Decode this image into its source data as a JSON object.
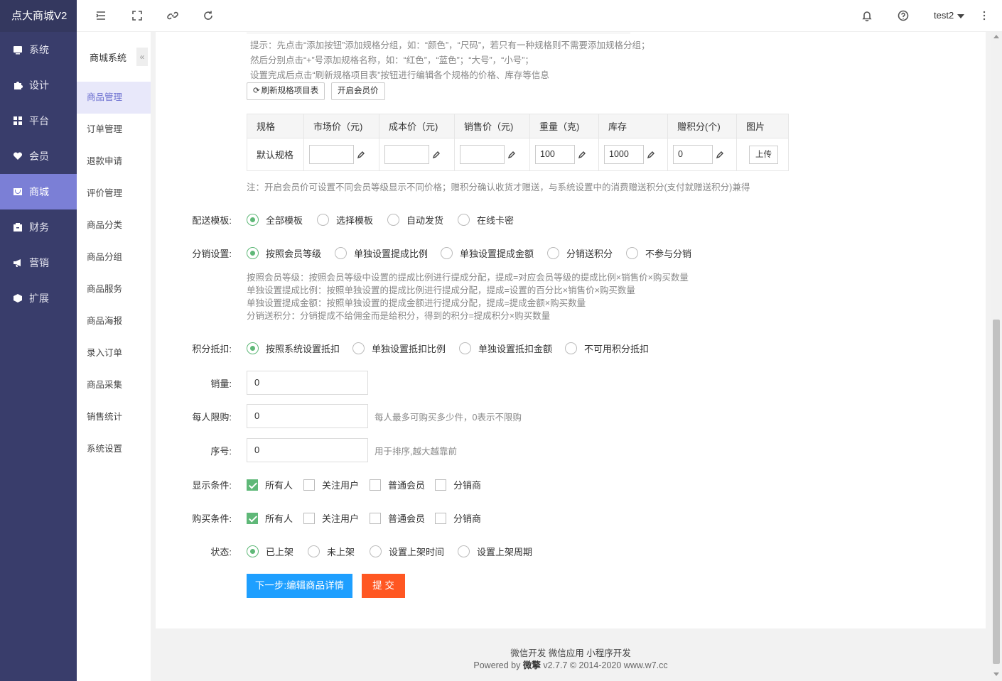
{
  "app": {
    "title": "点大商城V2"
  },
  "sidebar": {
    "items": [
      {
        "label": "系统",
        "icon": "monitor-icon"
      },
      {
        "label": "设计",
        "icon": "puzzle-icon"
      },
      {
        "label": "平台",
        "icon": "grid-icon"
      },
      {
        "label": "会员",
        "icon": "heart-icon"
      },
      {
        "label": "商城",
        "icon": "shop-icon",
        "active": true
      },
      {
        "label": "财务",
        "icon": "wallet-icon"
      },
      {
        "label": "营销",
        "icon": "megaphone-icon"
      },
      {
        "label": "扩展",
        "icon": "cube-icon"
      }
    ]
  },
  "topbar": {
    "user": "test2"
  },
  "subnav": {
    "title": "商城系统",
    "collapse": "«",
    "items": [
      "商品管理",
      "订单管理",
      "退款申请",
      "评价管理",
      "商品分类",
      "商品分组",
      "商品服务",
      "商品海报",
      "录入订单",
      "商品采集",
      "销售统计",
      "系统设置"
    ]
  },
  "spec": {
    "hints": [
      "提示：先点击“添加按钮”添加规格分组，如：“颜色”，“尺码”，若只有一种规格则不需要添加规格分组；",
      "然后分别点击“+”号添加规格名称，如：“红色”，“蓝色”；“大号”，“小号”；",
      "设置完成后点击“刷新规格项目表”按钮进行编辑各个规格的价格、库存等信息"
    ],
    "refresh_button": "刷新规格项目表",
    "member_price_button": "开启会员价",
    "columns": [
      "规格",
      "市场价（元)",
      "成本价（元)",
      "销售价（元)",
      "重量（克)",
      "库存",
      "赠积分(个)",
      "图片"
    ],
    "row": {
      "name": "默认规格",
      "market": "",
      "cost": "",
      "sell": "",
      "weight": "100",
      "stock": "1000",
      "points": "0",
      "upload": "上传"
    },
    "note": "注：开启会员价可设置不同会员等级显示不同价格；赠积分确认收货才赠送，与系统设置中的消费赠送积分(支付就赠送积分)兼得"
  },
  "form": {
    "delivery": {
      "label": "配送模板:",
      "options": [
        "全部模板",
        "选择模板",
        "自动发货",
        "在线卡密"
      ],
      "selected": 0
    },
    "distribution": {
      "label": "分销设置:",
      "options": [
        "按照会员等级",
        "单独设置提成比例",
        "单独设置提成金额",
        "分销送积分",
        "不参与分销"
      ],
      "selected": 0,
      "notes": [
        "按照会员等级：按照会员等级中设置的提成比例进行提成分配，提成=对应会员等级的提成比例×销售价×购买数量",
        "单独设置提成比例：按照单独设置的提成比例进行提成分配，提成=设置的百分比×销售价×购买数量",
        "单独设置提成金额：按照单独设置的提成金额进行提成分配，提成=提成金额×购买数量",
        "分销送积分：分销提成不给佣金而是给积分，得到的积分=提成积分×购买数量"
      ]
    },
    "points": {
      "label": "积分抵扣:",
      "options": [
        "按照系统设置抵扣",
        "单独设置抵扣比例",
        "单独设置抵扣金额",
        "不可用积分抵扣"
      ],
      "selected": 0
    },
    "sales": {
      "label": "销量:",
      "value": "0"
    },
    "limit": {
      "label": "每人限购:",
      "value": "0",
      "hint": "每人最多可购买多少件，0表示不限购"
    },
    "sort": {
      "label": "序号:",
      "value": "0",
      "hint": "用于排序,越大越靠前"
    },
    "show_cond": {
      "label": "显示条件:",
      "options": [
        "所有人",
        "关注用户",
        "普通会员",
        "分销商"
      ],
      "checked": [
        true,
        false,
        false,
        false
      ]
    },
    "buy_cond": {
      "label": "购买条件:",
      "options": [
        "所有人",
        "关注用户",
        "普通会员",
        "分销商"
      ],
      "checked": [
        true,
        false,
        false,
        false
      ]
    },
    "status": {
      "label": "状态:",
      "options": [
        "已上架",
        "未上架",
        "设置上架时间",
        "设置上架周期"
      ],
      "selected": 0
    },
    "next_button": "下一步:编辑商品详情",
    "submit_button": "提 交"
  },
  "footer": {
    "links": "微信开发 微信应用 小程序开发",
    "powered_prefix": "Powered by ",
    "brand": "微擎",
    "powered_suffix": " v2.7.7 © 2014-2020 www.w7.cc"
  },
  "colors": {
    "sidebar": "#393d6b",
    "active": "#7b7fd6",
    "primary": "#1e9fff",
    "danger": "#ff5722",
    "check": "#5fb878"
  }
}
